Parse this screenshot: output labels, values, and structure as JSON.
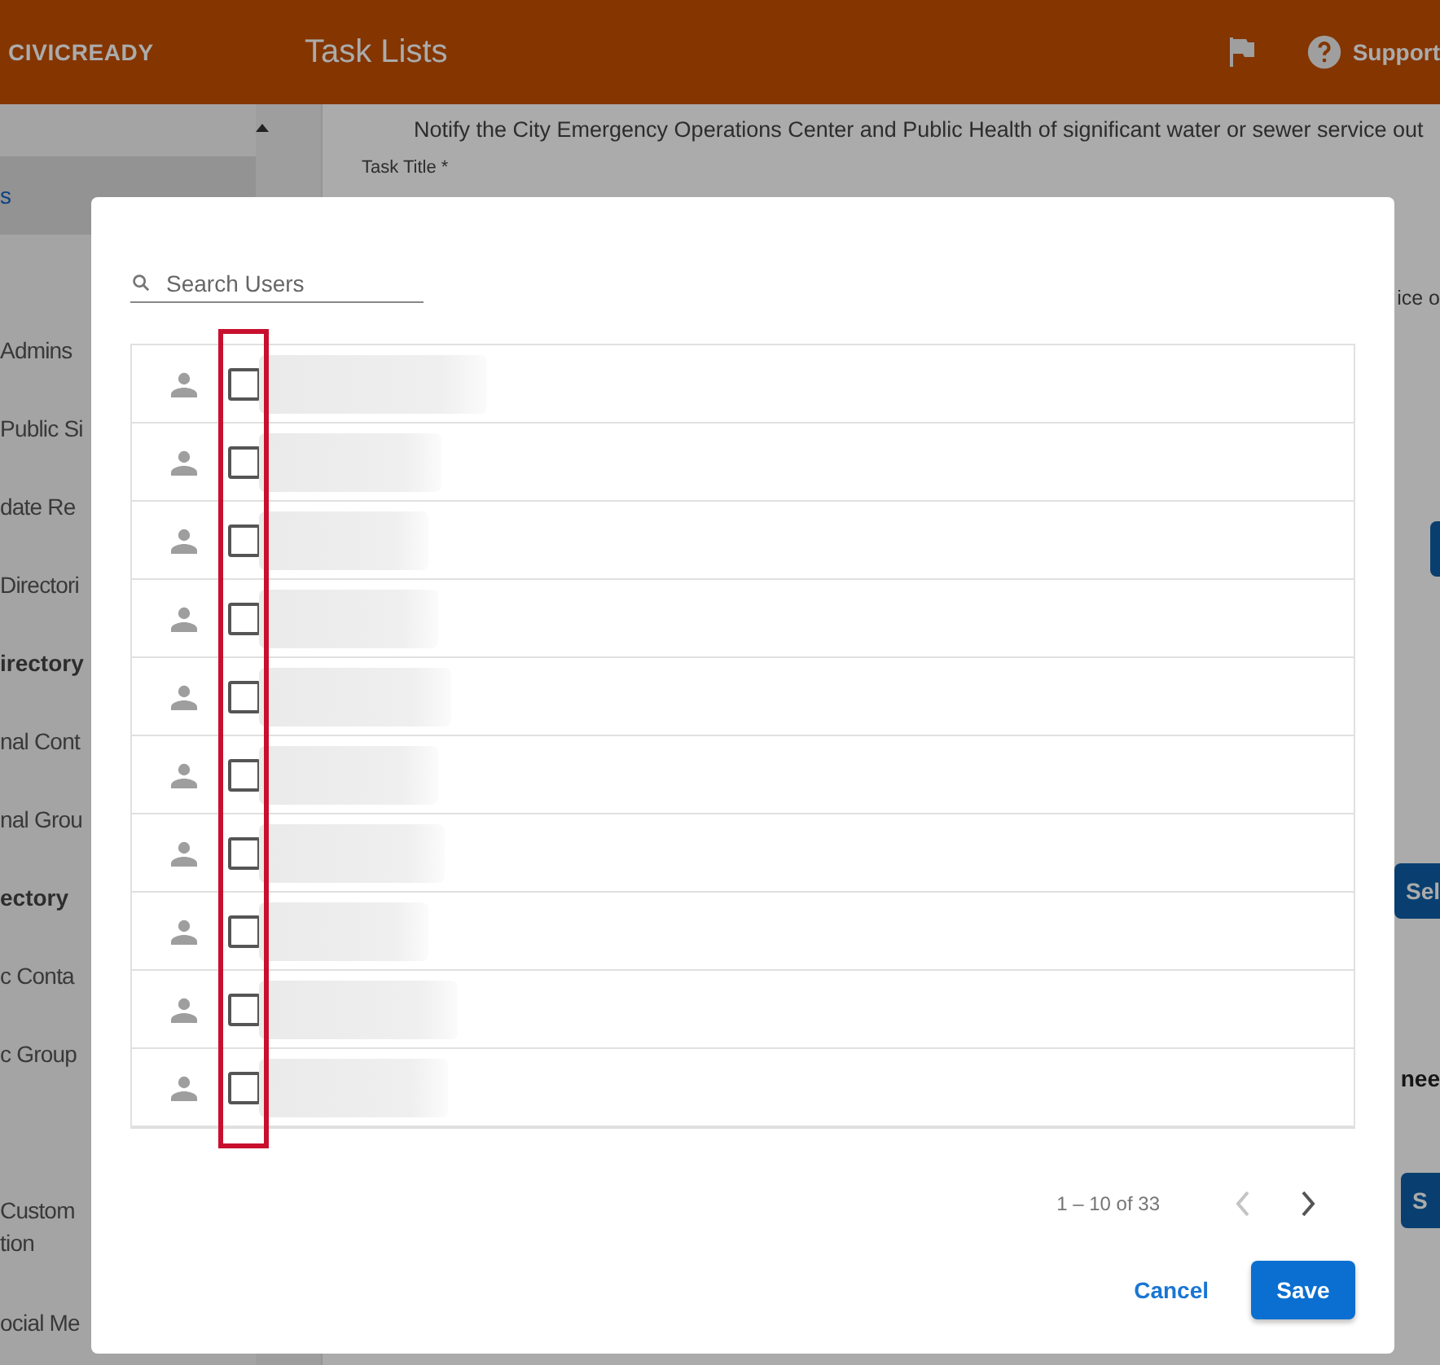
{
  "header": {
    "logo": "CIVICREADY",
    "title": "Task Lists",
    "support": "Support"
  },
  "sidebar": {
    "sections": [
      {
        "items": [
          {
            "label": "s",
            "selected": true
          }
        ]
      },
      {
        "items": [
          {
            "label": "Admins",
            "selected": false
          },
          {
            "label": "Public Si",
            "selected": false
          },
          {
            "label": "date Re",
            "selected": false
          },
          {
            "label": "Directori",
            "selected": false
          }
        ]
      },
      {
        "heading": "irectory",
        "items": [
          {
            "label": "nal Cont",
            "selected": false
          },
          {
            "label": "nal Grou",
            "selected": false
          }
        ]
      },
      {
        "heading": "ectory",
        "items": [
          {
            "label": "c Conta",
            "selected": false
          },
          {
            "label": "c Group",
            "selected": false
          }
        ]
      },
      {
        "items": [
          {
            "label": "Custom\ntion",
            "selected": false
          },
          {
            "label": "ocial Me",
            "selected": false
          }
        ]
      }
    ]
  },
  "content": {
    "description": "Notify the City Emergency Operations Center and Public Health of significant water or sewer service out",
    "field_label": "Task Title *",
    "right_fragments": [
      {
        "kind": "text",
        "text": "ice o"
      },
      {
        "kind": "button"
      },
      {
        "kind": "button",
        "text": "Sel"
      },
      {
        "kind": "heading",
        "text": "nee"
      },
      {
        "kind": "button",
        "text": "S"
      }
    ]
  },
  "dialog": {
    "search": {
      "placeholder": "Search Users"
    },
    "highlight_checkboxes": true,
    "rows": [
      {
        "checked": false
      },
      {
        "checked": false
      },
      {
        "checked": false
      },
      {
        "checked": false
      },
      {
        "checked": false
      },
      {
        "checked": false
      },
      {
        "checked": false
      },
      {
        "checked": false
      },
      {
        "checked": false
      },
      {
        "checked": false
      }
    ],
    "paginator": {
      "range": "1 – 10 of 33",
      "prev_disabled": true,
      "next_disabled": false
    },
    "buttons": [
      {
        "kind": "text",
        "label": "Cancel"
      },
      {
        "kind": "primary",
        "label": "Save"
      }
    ]
  }
}
